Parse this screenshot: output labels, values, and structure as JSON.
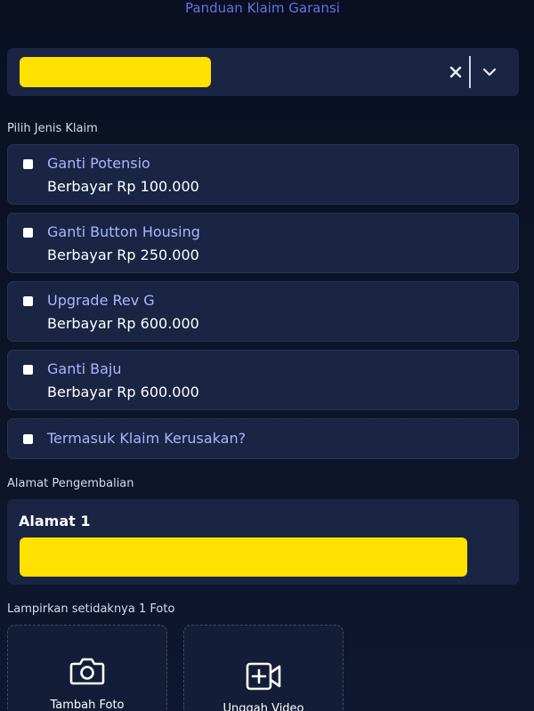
{
  "header": {
    "guide_link": "Panduan Klaim Garansi"
  },
  "product_select": {
    "clear_icon": "close-icon",
    "dropdown_icon": "chevron-down-icon",
    "value_redacted": true,
    "redaction_color": "#ffe100"
  },
  "claim_section": {
    "label": "Pilih Jenis Klaim",
    "options": [
      {
        "title": "Ganti Potensio",
        "price": "Berbayar Rp 100.000",
        "checked": false
      },
      {
        "title": "Ganti Button Housing",
        "price": "Berbayar Rp 250.000",
        "checked": false
      },
      {
        "title": "Upgrade Rev G",
        "price": "Berbayar Rp 600.000",
        "checked": false
      },
      {
        "title": "Ganti Baju",
        "price": "Berbayar Rp 600.000",
        "checked": false
      },
      {
        "title": "Termasuk Klaim Kerusakan?",
        "checked": false
      }
    ]
  },
  "return_address": {
    "label": "Alamat Pengembalian",
    "title": "Alamat 1",
    "value_redacted": true
  },
  "attachments": {
    "label": "Lampirkan setidaknya 1 Foto",
    "add_photo_label": "Tambah Foto",
    "add_photo_icon": "camera-icon",
    "upload_video_label": "Unggah Video",
    "upload_video_icon": "video-plus-icon"
  },
  "colors": {
    "background": "#0c1225",
    "card": "#1a2544",
    "accent_link": "#6b6ee0",
    "option_title": "#a9b6ff"
  }
}
